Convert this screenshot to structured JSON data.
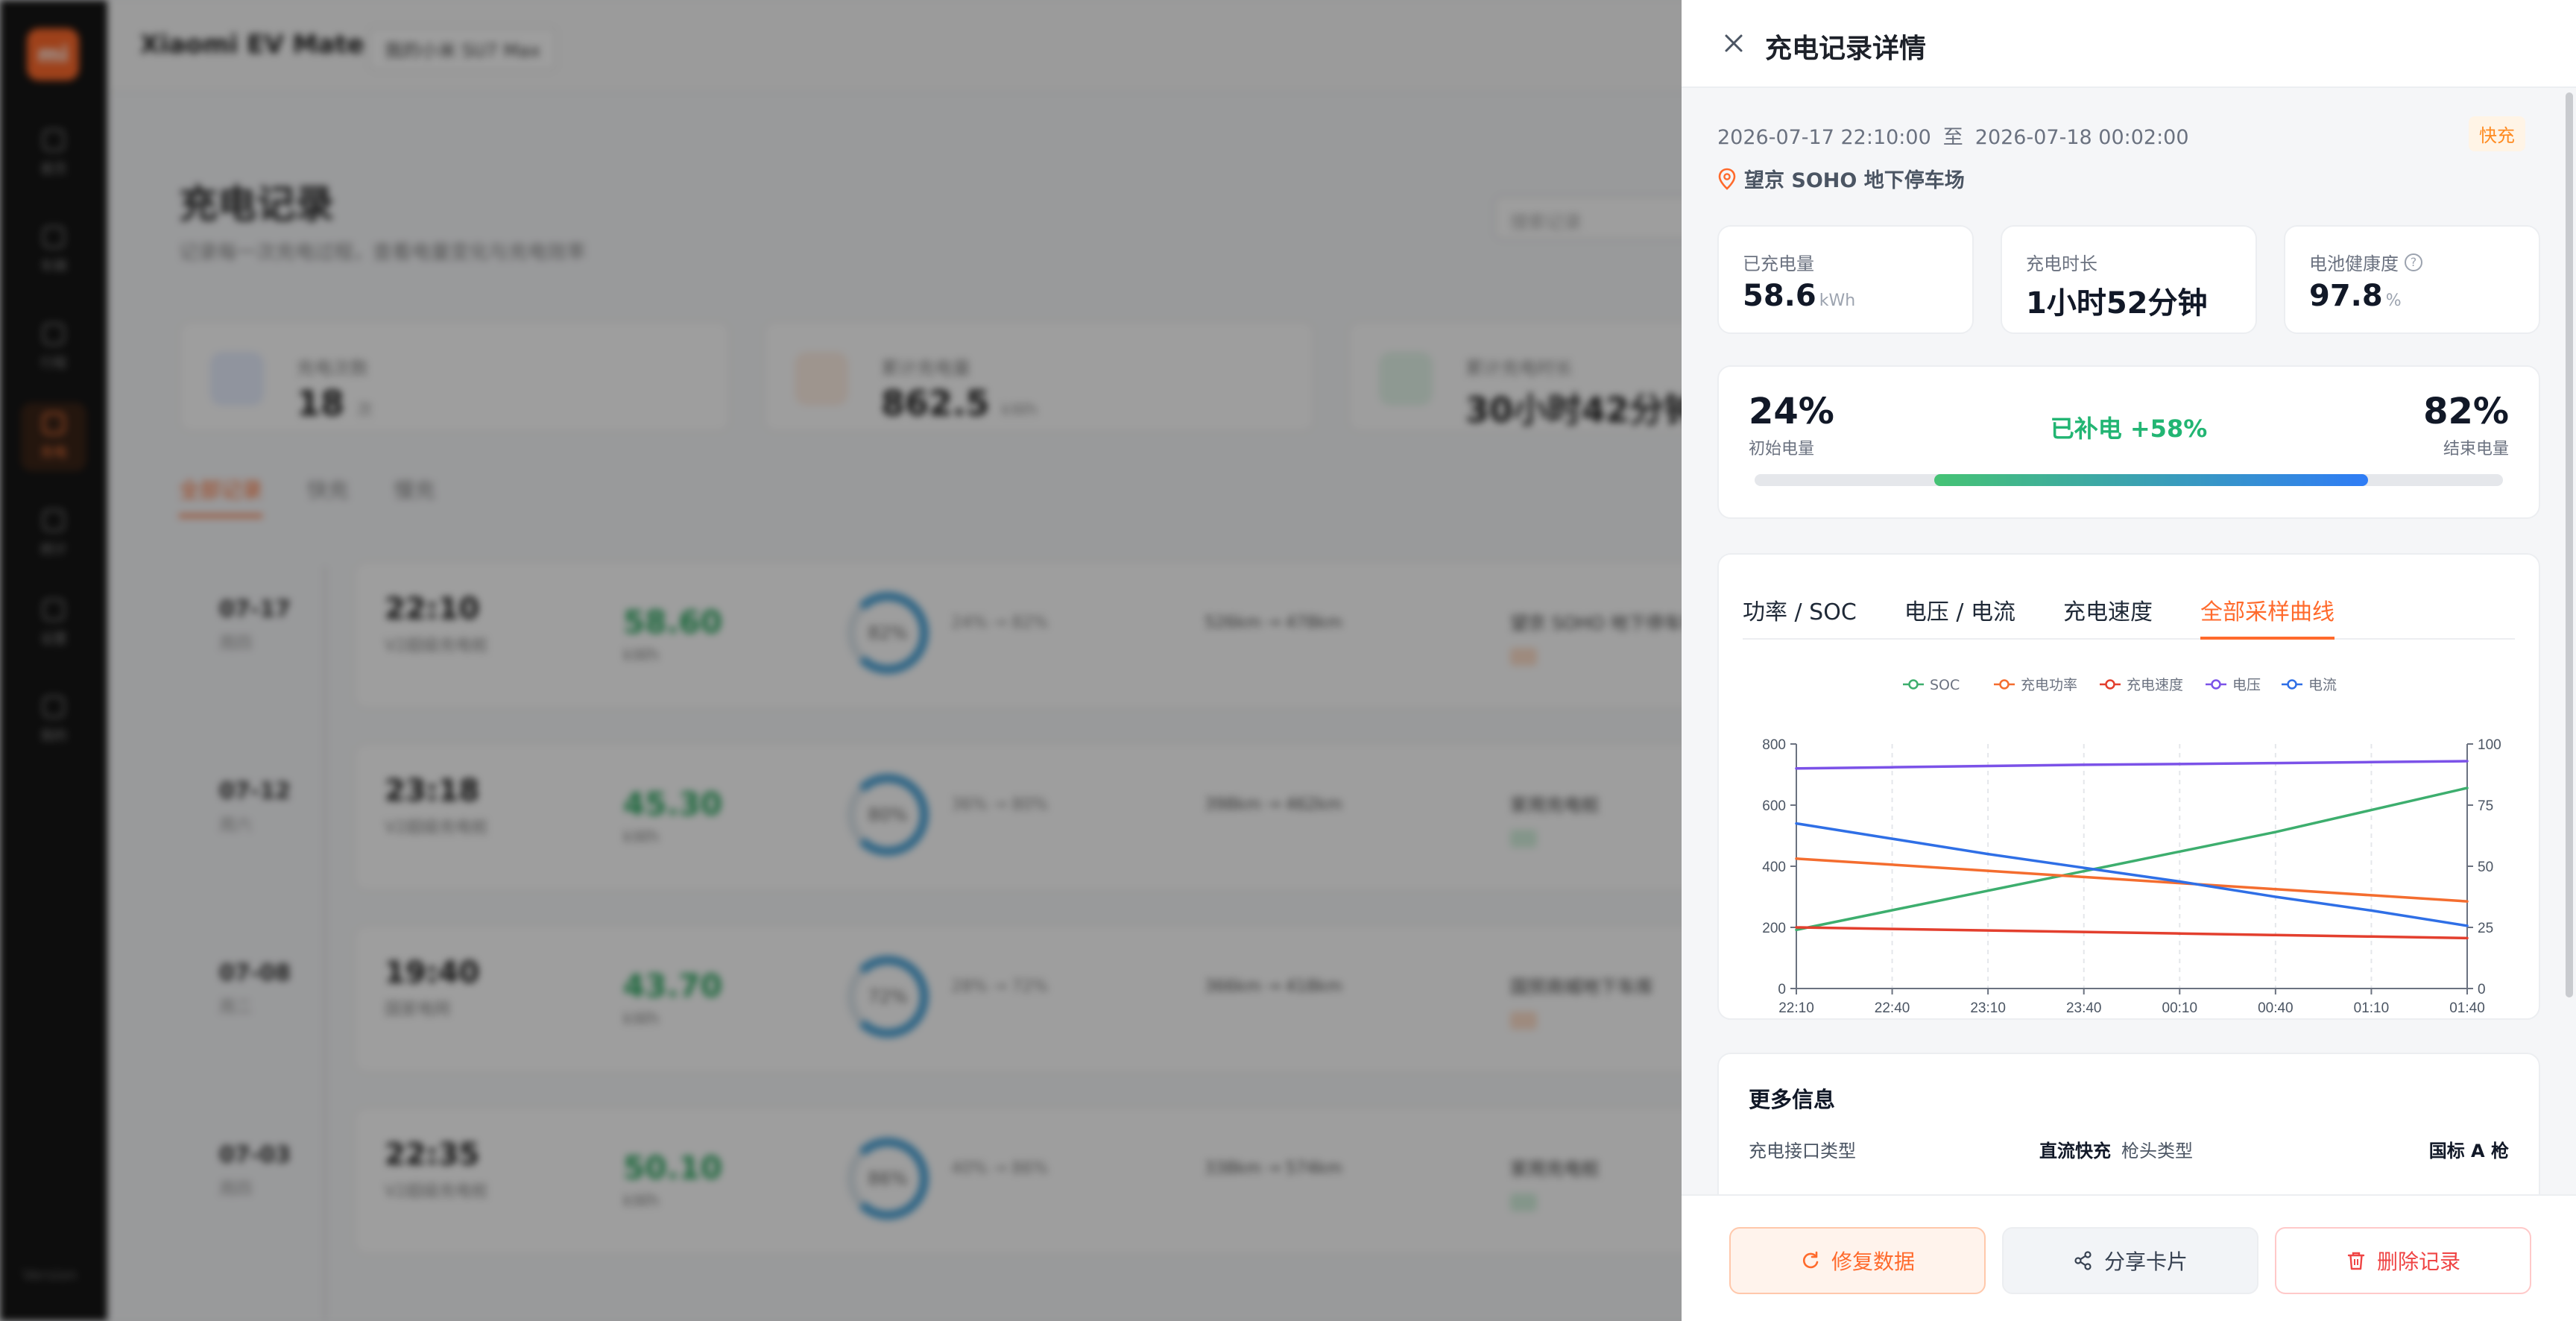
{
  "background": {
    "sidebar": {
      "logo": "mi",
      "items": [
        "首页",
        "车辆",
        "行程",
        "充电",
        "统计",
        "设置",
        "我的"
      ],
      "version": "Version"
    },
    "brand": "Xiaomi EV Mate",
    "car_select": "我的小米 SU7 Max",
    "title": "充电记录",
    "subtitle": "记录每一次充电过程，查看电量变化与充电效率",
    "search_placeholder": "搜索记录",
    "stats": [
      {
        "label": "充电次数",
        "value": "18",
        "unit": "次"
      },
      {
        "label": "累计充电量",
        "value": "862.5",
        "unit": "kWh"
      },
      {
        "label": "累计充电时长",
        "value": "30小时42分钟",
        "unit": ""
      }
    ],
    "tabs": [
      "全部记录",
      "快充",
      "慢充"
    ],
    "records": [
      {
        "date": "07-17",
        "week": "周四",
        "time": "22:10",
        "site": "V2超级充电桩",
        "kwh": "58.60",
        "soc": "82%",
        "soc_range": "24% → 82%",
        "range": "526km → 478km",
        "loc": "望京 SOHO 地下停车场"
      },
      {
        "date": "07-12",
        "week": "周六",
        "time": "23:18",
        "site": "V2超级充电桩",
        "kwh": "45.30",
        "soc": "80%",
        "soc_range": "36% → 80%",
        "range": "398km → 462km",
        "loc": "家用充电桩"
      },
      {
        "date": "07-08",
        "week": "周二",
        "time": "19:40",
        "site": "国家电网",
        "kwh": "43.70",
        "soc": "72%",
        "soc_range": "28% → 72%",
        "range": "366km → 418km",
        "loc": "国贸商城地下车库"
      },
      {
        "date": "07-03",
        "week": "周四",
        "time": "22:35",
        "site": "V2超级充电桩",
        "kwh": "50.10",
        "soc": "86%",
        "soc_range": "40% → 86%",
        "range": "338km → 574km",
        "loc": "家用充电桩"
      }
    ]
  },
  "drawer": {
    "title": "充电记录详情",
    "start_time": "2026-07-17 22:10:00",
    "to": "至",
    "end_time": "2026-07-18 00:02:00",
    "badge": "快充",
    "location": "望京 SOHO 地下停车场",
    "kpis": [
      {
        "label": "已充电量",
        "value": "58.6",
        "unit": "kWh"
      },
      {
        "label": "充电时长",
        "value": "1小时52分钟",
        "unit": ""
      },
      {
        "label": "电池健康度",
        "value": "97.8",
        "unit": "%"
      }
    ],
    "soc": {
      "start": "24%",
      "start_label": "初始电量",
      "end": "82%",
      "end_label": "结束电量",
      "added": "已补电 +58%",
      "start_value": 24,
      "end_value": 82
    },
    "chart_tabs": [
      "功率 / SOC",
      "电压 / 电流",
      "充电速度",
      "全部采样曲线"
    ],
    "active_tab": 3,
    "more": {
      "title": "更多信息",
      "row_label_1": "充电接口类型",
      "row_value_1": "直流快充",
      "row_label_2": "枪头类型",
      "row_value_2": "国标 A 枪"
    },
    "buttons": {
      "repair": "修复数据",
      "share": "分享卡片",
      "delete": "删除记录"
    }
  },
  "colors": {
    "accent": "#ff6a2c",
    "green": "#22b573",
    "blue": "#2f7cf6",
    "danger": "#ef4444"
  },
  "chart_data": {
    "type": "line",
    "x": [
      "22:10",
      "22:40",
      "23:10",
      "23:40",
      "00:10",
      "00:40",
      "01:10",
      "01:40"
    ],
    "y_left": {
      "min": 0,
      "max": 800,
      "ticks": [
        0,
        200,
        400,
        600,
        800
      ]
    },
    "y_right": {
      "min": 0,
      "max": 100,
      "ticks": [
        0,
        25,
        50,
        75,
        100
      ]
    },
    "grid": true,
    "legend": "top-center",
    "series": [
      {
        "name": "SOC",
        "color": "#3dae6e",
        "axis": "right",
        "values": [
          24,
          32,
          40,
          48,
          56,
          64,
          73,
          82
        ]
      },
      {
        "name": "充电功率",
        "color": "#f46d2f",
        "axis": "left",
        "values": [
          425,
          405,
          385,
          365,
          345,
          325,
          305,
          285
        ]
      },
      {
        "name": "充电速度",
        "color": "#e33f2e",
        "axis": "left",
        "values": [
          200,
          195,
          190,
          185,
          180,
          175,
          170,
          165
        ]
      },
      {
        "name": "电压",
        "color": "#7b52e8",
        "axis": "right",
        "values": [
          90,
          90.5,
          91,
          91.5,
          91.8,
          92.2,
          92.6,
          93
        ]
      },
      {
        "name": "电流",
        "color": "#2f6fe6",
        "axis": "left",
        "values": [
          540,
          490,
          440,
          395,
          350,
          300,
          255,
          205
        ]
      }
    ]
  }
}
